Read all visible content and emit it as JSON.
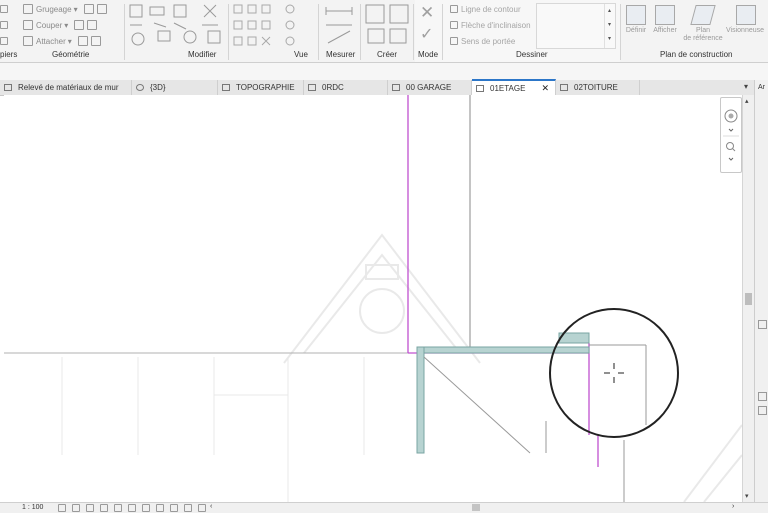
{
  "ribbon": {
    "geometrie": {
      "clipboard_partial": "piers",
      "grugeage": "Grugeage",
      "couper": "Couper",
      "attacher": "Attacher",
      "label": "Géométrie"
    },
    "modifier": {
      "label": "Modifier"
    },
    "vue": {
      "label": "Vue"
    },
    "mesurer": {
      "label": "Mesurer"
    },
    "creer": {
      "label": "Créer"
    },
    "mode": {
      "label": "Mode"
    },
    "dessiner": {
      "label": "Dessiner",
      "ligne_contour": "Ligne de contour",
      "fleche_inclinaison": "Flèche d'inclinaison",
      "sens_portee": "Sens de portée"
    },
    "plan_construction": {
      "label": "Plan de construction",
      "definir": "Définir",
      "afficher": "Afficher",
      "plan_ref_line1": "Plan",
      "plan_ref_line2": "de référence",
      "visionneuse": "Visionneuse"
    }
  },
  "tabs": [
    {
      "label": "Relevé de matériaux de mur"
    },
    {
      "label": "{3D}"
    },
    {
      "label": "TOPOGRAPHIE"
    },
    {
      "label": "0RDC"
    },
    {
      "label": "00 GARAGE"
    },
    {
      "label": "01ETAGE",
      "active": true,
      "close": "✕"
    },
    {
      "label": "02TOITURE"
    }
  ],
  "right_panel": {
    "label_partial": "Ar"
  },
  "status": {
    "scale": "1 : 100"
  },
  "colors": {
    "accent": "#2c76c8",
    "sketch_magenta": "#c050d0",
    "wall_fill": "#b7d3d1",
    "wall_stroke": "#7aa5a3"
  },
  "icons": [
    "close-icon",
    "check-icon",
    "steering-wheel-icon",
    "zoom-icon",
    "cursor-crosshair-icon"
  ]
}
